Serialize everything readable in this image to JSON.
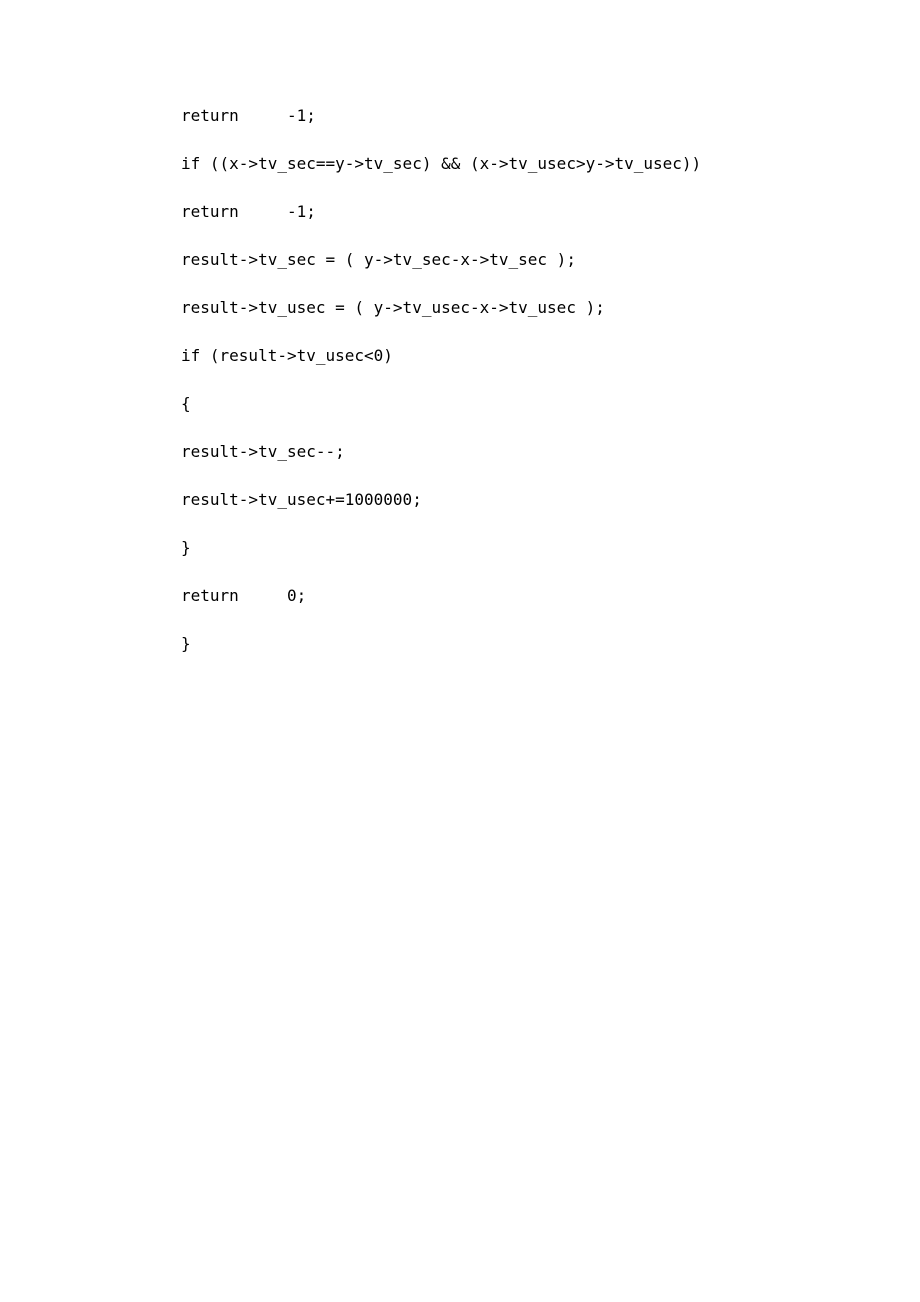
{
  "code_lines": [
    "return     -1;",
    "if ((x->tv_sec==y->tv_sec) && (x->tv_usec>y->tv_usec))",
    "return     -1;",
    "result->tv_sec = ( y->tv_sec-x->tv_sec );",
    "result->tv_usec = ( y->tv_usec-x->tv_usec );",
    "if (result->tv_usec<0)",
    "{",
    "result->tv_sec--;",
    "result->tv_usec+=1000000;",
    "}",
    "return     0;",
    "}"
  ]
}
